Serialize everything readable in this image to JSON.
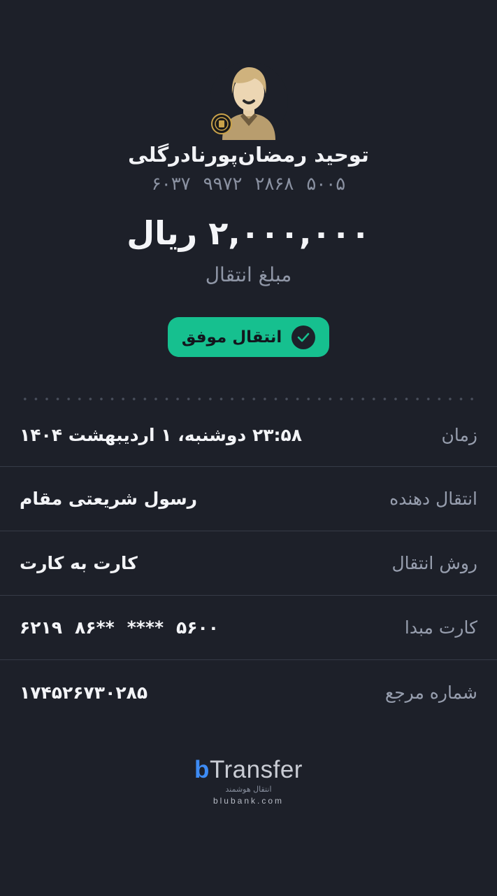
{
  "recipient": {
    "name": "توحید رمضان‌پورنادرگلی",
    "card_groups": [
      "۶۰۳۷",
      "۹۹۷۲",
      "۲۸۶۸",
      "۵۰۰۵"
    ]
  },
  "transfer": {
    "amount": "۲,۰۰۰,۰۰۰ ریال",
    "amount_label": "مبلغ انتقال",
    "status": "انتقال موفق"
  },
  "details": [
    {
      "label": "زمان",
      "value": "۲۳:۵۸ دوشنبه، ۱ اردیبهشت ۱۴۰۴"
    },
    {
      "label": "انتقال دهنده",
      "value": "رسول شریعتی مقام"
    },
    {
      "label": "روش انتقال",
      "value": "کارت به کارت"
    },
    {
      "label": "کارت مبدا",
      "value_groups": [
        "۶۲۱۹",
        "۸۶**",
        "****",
        "۵۶۰۰"
      ]
    },
    {
      "label": "شماره مرجع",
      "value": "۱۷۴۵۲۶۷۳۰۲۸۵"
    }
  ],
  "brand": {
    "logo_b": "b",
    "logo_rest": "Transfer",
    "tagline": "انتقال هوشمند",
    "domain": "blubank.com"
  },
  "icons": {
    "avatar": "user-avatar-icon",
    "bank_badge": "bank-logo-icon",
    "status": "check-circle-icon"
  },
  "colors": {
    "background": "#1d2029",
    "success": "#16c08f",
    "brand_blue": "#3d8bf4"
  }
}
